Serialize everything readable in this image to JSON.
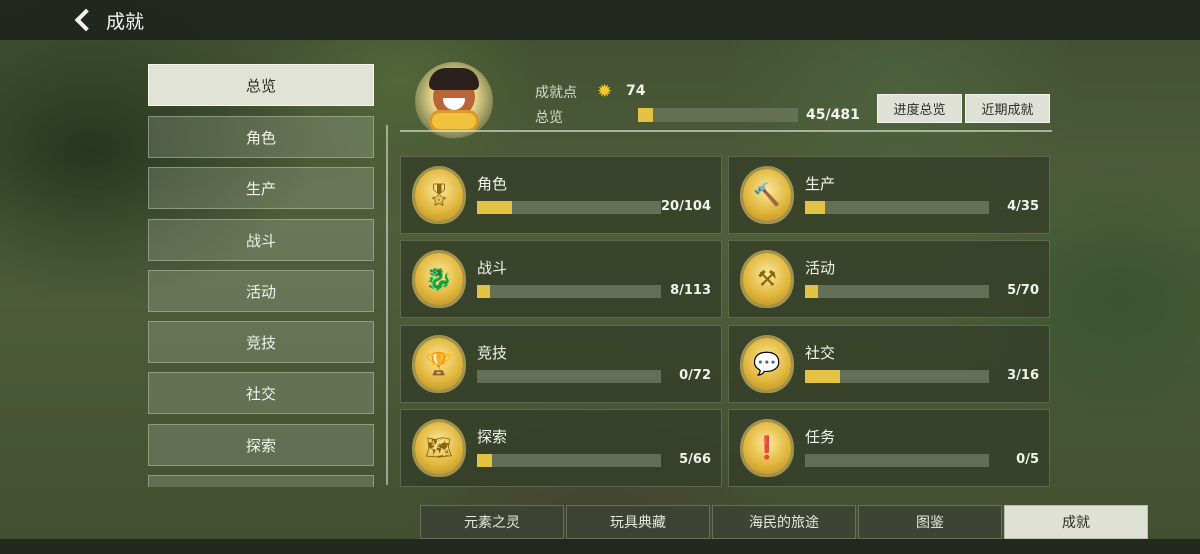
{
  "header": {
    "title": "成就"
  },
  "sidebar": {
    "items": [
      {
        "label": "总览",
        "active": true
      },
      {
        "label": "角色",
        "active": false
      },
      {
        "label": "生产",
        "active": false
      },
      {
        "label": "战斗",
        "active": false
      },
      {
        "label": "活动",
        "active": false
      },
      {
        "label": "竞技",
        "active": false
      },
      {
        "label": "社交",
        "active": false
      },
      {
        "label": "探索",
        "active": false
      }
    ]
  },
  "overview": {
    "points_label": "成就点",
    "points_value": "74",
    "overview_label": "总览",
    "total_progress": "45/481",
    "total_fraction": 0.094,
    "btn_progress": "进度总览",
    "btn_recent": "近期成就"
  },
  "cards": [
    {
      "name": "角色",
      "count": "20/104",
      "fraction": 0.19,
      "icon": "medal-icon",
      "glyph": "🎖"
    },
    {
      "name": "生产",
      "count": "4/35",
      "fraction": 0.11,
      "icon": "hammer-icon",
      "glyph": "🔨"
    },
    {
      "name": "战斗",
      "count": "8/113",
      "fraction": 0.07,
      "icon": "dragon-icon",
      "glyph": "🐉"
    },
    {
      "name": "活动",
      "count": "5/70",
      "fraction": 0.07,
      "icon": "anvil-icon",
      "glyph": "⚒"
    },
    {
      "name": "竞技",
      "count": "0/72",
      "fraction": 0.0,
      "icon": "trophy-icon",
      "glyph": "🏆"
    },
    {
      "name": "社交",
      "count": "3/16",
      "fraction": 0.19,
      "icon": "chat-icon",
      "glyph": "💬"
    },
    {
      "name": "探索",
      "count": "5/66",
      "fraction": 0.08,
      "icon": "map-icon",
      "glyph": "🗺"
    },
    {
      "name": "任务",
      "count": "0/5",
      "fraction": 0.0,
      "icon": "quest-icon",
      "glyph": "❗"
    }
  ],
  "bottom_tabs": [
    {
      "label": "元素之灵",
      "active": false
    },
    {
      "label": "玩具典藏",
      "active": false
    },
    {
      "label": "海民的旅途",
      "active": false
    },
    {
      "label": "图鉴",
      "active": false
    },
    {
      "label": "成就",
      "active": true
    }
  ],
  "colors": {
    "accent": "#e4c344",
    "panel": "#344a28",
    "active_tab": "#e0e1d6"
  }
}
